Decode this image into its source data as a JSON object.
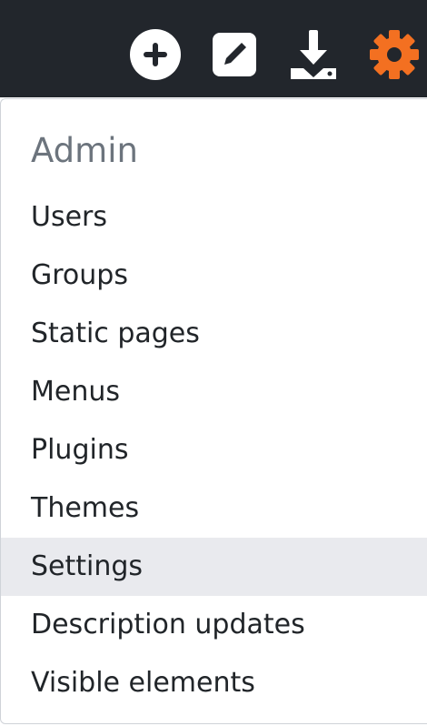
{
  "toolbar": {
    "buttons": [
      {
        "name": "add",
        "icon": "plus-circle-icon",
        "color": "#ffffff"
      },
      {
        "name": "edit",
        "icon": "edit-icon",
        "color": "#ffffff"
      },
      {
        "name": "download",
        "icon": "download-icon",
        "color": "#ffffff"
      },
      {
        "name": "settings",
        "icon": "gear-icon",
        "color": "#f37021"
      }
    ],
    "background": "#22262c"
  },
  "dropdown": {
    "header": "Admin",
    "items": [
      {
        "label": "Users",
        "active": false
      },
      {
        "label": "Groups",
        "active": false
      },
      {
        "label": "Static pages",
        "active": false
      },
      {
        "label": "Menus",
        "active": false
      },
      {
        "label": "Plugins",
        "active": false
      },
      {
        "label": "Themes",
        "active": false
      },
      {
        "label": "Settings",
        "active": true
      },
      {
        "label": "Description updates",
        "active": false
      },
      {
        "label": "Visible elements",
        "active": false
      }
    ]
  }
}
